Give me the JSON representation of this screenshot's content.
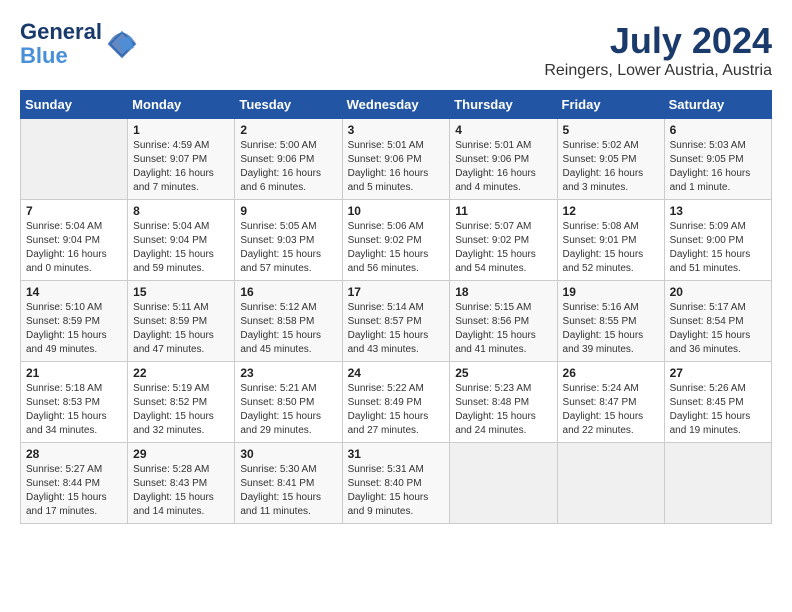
{
  "header": {
    "logo_line1": "General",
    "logo_line2": "Blue",
    "month": "July 2024",
    "location": "Reingers, Lower Austria, Austria"
  },
  "weekdays": [
    "Sunday",
    "Monday",
    "Tuesday",
    "Wednesday",
    "Thursday",
    "Friday",
    "Saturday"
  ],
  "weeks": [
    [
      {
        "day": "",
        "sunrise": "",
        "sunset": "",
        "daylight": ""
      },
      {
        "day": "1",
        "sunrise": "Sunrise: 4:59 AM",
        "sunset": "Sunset: 9:07 PM",
        "daylight": "Daylight: 16 hours and 7 minutes."
      },
      {
        "day": "2",
        "sunrise": "Sunrise: 5:00 AM",
        "sunset": "Sunset: 9:06 PM",
        "daylight": "Daylight: 16 hours and 6 minutes."
      },
      {
        "day": "3",
        "sunrise": "Sunrise: 5:01 AM",
        "sunset": "Sunset: 9:06 PM",
        "daylight": "Daylight: 16 hours and 5 minutes."
      },
      {
        "day": "4",
        "sunrise": "Sunrise: 5:01 AM",
        "sunset": "Sunset: 9:06 PM",
        "daylight": "Daylight: 16 hours and 4 minutes."
      },
      {
        "day": "5",
        "sunrise": "Sunrise: 5:02 AM",
        "sunset": "Sunset: 9:05 PM",
        "daylight": "Daylight: 16 hours and 3 minutes."
      },
      {
        "day": "6",
        "sunrise": "Sunrise: 5:03 AM",
        "sunset": "Sunset: 9:05 PM",
        "daylight": "Daylight: 16 hours and 1 minute."
      }
    ],
    [
      {
        "day": "7",
        "sunrise": "Sunrise: 5:04 AM",
        "sunset": "Sunset: 9:04 PM",
        "daylight": "Daylight: 16 hours and 0 minutes."
      },
      {
        "day": "8",
        "sunrise": "Sunrise: 5:04 AM",
        "sunset": "Sunset: 9:04 PM",
        "daylight": "Daylight: 15 hours and 59 minutes."
      },
      {
        "day": "9",
        "sunrise": "Sunrise: 5:05 AM",
        "sunset": "Sunset: 9:03 PM",
        "daylight": "Daylight: 15 hours and 57 minutes."
      },
      {
        "day": "10",
        "sunrise": "Sunrise: 5:06 AM",
        "sunset": "Sunset: 9:02 PM",
        "daylight": "Daylight: 15 hours and 56 minutes."
      },
      {
        "day": "11",
        "sunrise": "Sunrise: 5:07 AM",
        "sunset": "Sunset: 9:02 PM",
        "daylight": "Daylight: 15 hours and 54 minutes."
      },
      {
        "day": "12",
        "sunrise": "Sunrise: 5:08 AM",
        "sunset": "Sunset: 9:01 PM",
        "daylight": "Daylight: 15 hours and 52 minutes."
      },
      {
        "day": "13",
        "sunrise": "Sunrise: 5:09 AM",
        "sunset": "Sunset: 9:00 PM",
        "daylight": "Daylight: 15 hours and 51 minutes."
      }
    ],
    [
      {
        "day": "14",
        "sunrise": "Sunrise: 5:10 AM",
        "sunset": "Sunset: 8:59 PM",
        "daylight": "Daylight: 15 hours and 49 minutes."
      },
      {
        "day": "15",
        "sunrise": "Sunrise: 5:11 AM",
        "sunset": "Sunset: 8:59 PM",
        "daylight": "Daylight: 15 hours and 47 minutes."
      },
      {
        "day": "16",
        "sunrise": "Sunrise: 5:12 AM",
        "sunset": "Sunset: 8:58 PM",
        "daylight": "Daylight: 15 hours and 45 minutes."
      },
      {
        "day": "17",
        "sunrise": "Sunrise: 5:14 AM",
        "sunset": "Sunset: 8:57 PM",
        "daylight": "Daylight: 15 hours and 43 minutes."
      },
      {
        "day": "18",
        "sunrise": "Sunrise: 5:15 AM",
        "sunset": "Sunset: 8:56 PM",
        "daylight": "Daylight: 15 hours and 41 minutes."
      },
      {
        "day": "19",
        "sunrise": "Sunrise: 5:16 AM",
        "sunset": "Sunset: 8:55 PM",
        "daylight": "Daylight: 15 hours and 39 minutes."
      },
      {
        "day": "20",
        "sunrise": "Sunrise: 5:17 AM",
        "sunset": "Sunset: 8:54 PM",
        "daylight": "Daylight: 15 hours and 36 minutes."
      }
    ],
    [
      {
        "day": "21",
        "sunrise": "Sunrise: 5:18 AM",
        "sunset": "Sunset: 8:53 PM",
        "daylight": "Daylight: 15 hours and 34 minutes."
      },
      {
        "day": "22",
        "sunrise": "Sunrise: 5:19 AM",
        "sunset": "Sunset: 8:52 PM",
        "daylight": "Daylight: 15 hours and 32 minutes."
      },
      {
        "day": "23",
        "sunrise": "Sunrise: 5:21 AM",
        "sunset": "Sunset: 8:50 PM",
        "daylight": "Daylight: 15 hours and 29 minutes."
      },
      {
        "day": "24",
        "sunrise": "Sunrise: 5:22 AM",
        "sunset": "Sunset: 8:49 PM",
        "daylight": "Daylight: 15 hours and 27 minutes."
      },
      {
        "day": "25",
        "sunrise": "Sunrise: 5:23 AM",
        "sunset": "Sunset: 8:48 PM",
        "daylight": "Daylight: 15 hours and 24 minutes."
      },
      {
        "day": "26",
        "sunrise": "Sunrise: 5:24 AM",
        "sunset": "Sunset: 8:47 PM",
        "daylight": "Daylight: 15 hours and 22 minutes."
      },
      {
        "day": "27",
        "sunrise": "Sunrise: 5:26 AM",
        "sunset": "Sunset: 8:45 PM",
        "daylight": "Daylight: 15 hours and 19 minutes."
      }
    ],
    [
      {
        "day": "28",
        "sunrise": "Sunrise: 5:27 AM",
        "sunset": "Sunset: 8:44 PM",
        "daylight": "Daylight: 15 hours and 17 minutes."
      },
      {
        "day": "29",
        "sunrise": "Sunrise: 5:28 AM",
        "sunset": "Sunset: 8:43 PM",
        "daylight": "Daylight: 15 hours and 14 minutes."
      },
      {
        "day": "30",
        "sunrise": "Sunrise: 5:30 AM",
        "sunset": "Sunset: 8:41 PM",
        "daylight": "Daylight: 15 hours and 11 minutes."
      },
      {
        "day": "31",
        "sunrise": "Sunrise: 5:31 AM",
        "sunset": "Sunset: 8:40 PM",
        "daylight": "Daylight: 15 hours and 9 minutes."
      },
      {
        "day": "",
        "sunrise": "",
        "sunset": "",
        "daylight": ""
      },
      {
        "day": "",
        "sunrise": "",
        "sunset": "",
        "daylight": ""
      },
      {
        "day": "",
        "sunrise": "",
        "sunset": "",
        "daylight": ""
      }
    ]
  ]
}
